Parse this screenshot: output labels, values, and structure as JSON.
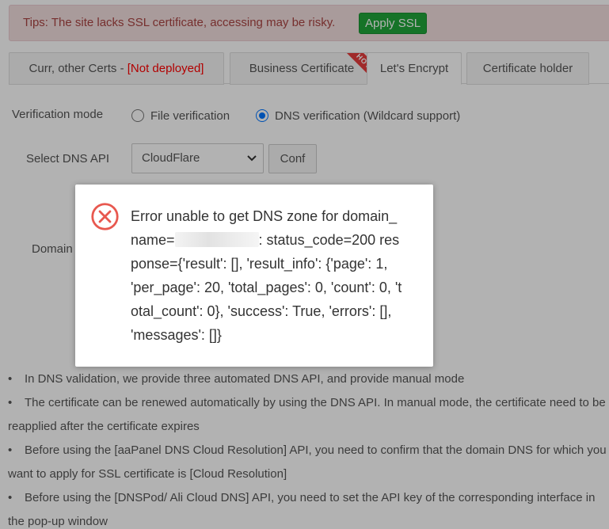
{
  "tips": {
    "text": "Tips: The site lacks SSL certificate, accessing may be risky.",
    "apply_label": "Apply SSL"
  },
  "tabs": [
    {
      "label": "Curr, other Certs - ",
      "status": "[Not deployed]"
    },
    {
      "label": "Business Certificate",
      "badge": "HOT"
    },
    {
      "label": "Let's Encrypt"
    },
    {
      "label": "Certificate holder"
    }
  ],
  "form": {
    "verification_label": "Verification mode",
    "option_file": "File verification",
    "option_dns": "DNS verification (Wildcard support)",
    "dns_api_label": "Select DNS API",
    "dns_api_value": "CloudFlare",
    "conf_label": "Conf",
    "domain_label": "Domain"
  },
  "notes": [
    "In DNS validation, we provide three automated DNS API, and provide manual mode",
    "The certificate can be renewed automatically by using the DNS API. In manual mode, the certificate need to be",
    "reapplied after the certificate expires",
    "Before using the [aaPanel DNS Cloud Resolution] API, you need to confirm that the domain DNS for which you",
    "want to apply for SSL certificate is [Cloud Resolution]",
    "Before using the [DNSPod/ Ali Cloud DNS] API, you need to set the API key of the corresponding interface in",
    "the pop-up window"
  ],
  "dialog": {
    "line1": "Error unable to get DNS zone for domain_",
    "line2_pre": "name=",
    "line2_post": ": status_code=200 res",
    "line3": "ponse={'result': [], 'result_info': {'page': 1,",
    "line4": "'per_page': 20, 'total_pages': 0, 'count': 0, 't",
    "line5": "otal_count': 0}, 'success': True, 'errors': [],",
    "line6": "'messages': []}"
  },
  "colors": {
    "error_red": "#e8584f",
    "apply_green": "#20a53a",
    "radio_blue": "#0075ff"
  }
}
